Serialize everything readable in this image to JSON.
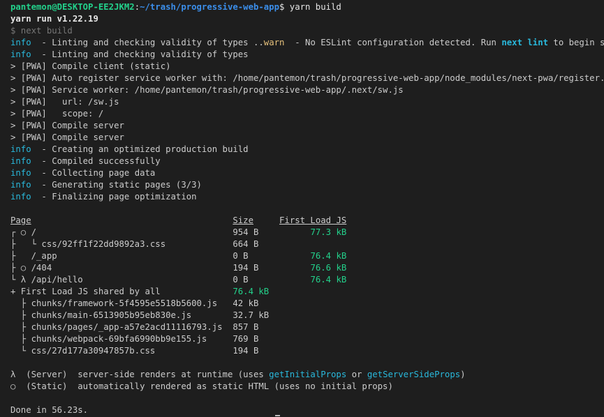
{
  "prompt": {
    "user_host": "pantemon@DESKTOP-EE2JKM2",
    "sep": ":",
    "path": "~/trash/progressive-web-app",
    "dollar": "$",
    "command": " yarn build"
  },
  "yarn_header": "yarn run v1.22.19",
  "next_build": "$ next build",
  "log1": {
    "tag": "info",
    "text": "  - Linting and checking validity of types ",
    "dots": "..",
    "warn": "warn",
    "pre": "  - No ESLint configuration detected. Run ",
    "cmd": "next lint",
    "post": " to begin setup"
  },
  "log2": {
    "tag": "info",
    "text": "  - Linting and checking validity of types"
  },
  "pwa_lines": [
    "> [PWA] Compile client (static)",
    "> [PWA] Auto register service worker with: /home/pantemon/trash/progressive-web-app/node_modules/next-pwa/register.js",
    "> [PWA] Service worker: /home/pantemon/trash/progressive-web-app/.next/sw.js",
    "> [PWA]   url: /sw.js",
    "> [PWA]   scope: /",
    "> [PWA] Compile server",
    "> [PWA] Compile server"
  ],
  "info_lines": [
    {
      "tag": "info",
      "text": "  - Creating an optimized production build"
    },
    {
      "tag": "info",
      "text": "  - Compiled successfully"
    },
    {
      "tag": "info",
      "text": "  - Collecting page data"
    },
    {
      "tag": "info",
      "text": "  - Generating static pages (3/3)"
    },
    {
      "tag": "info",
      "text": "  - Finalizing page optimization"
    }
  ],
  "table": {
    "page_label": "Page",
    "size_label": "Size",
    "first_load_label": "First Load JS",
    "rows": [
      {
        "tree": "┌ ○ ",
        "name": "/",
        "size": "954 B",
        "first_load": "77.3 kB"
      },
      {
        "tree": "├   └ ",
        "name": "css/92ff1f22dd9892a3.css",
        "size": "664 B",
        "first_load": ""
      },
      {
        "tree": "├   ",
        "name": "/_app",
        "size": "0 B",
        "first_load": "76.4 kB"
      },
      {
        "tree": "├ ○ ",
        "name": "/404",
        "size": "194 B",
        "first_load": "76.6 kB"
      },
      {
        "tree": "└ λ ",
        "name": "/api/hello",
        "size": "0 B",
        "first_load": "76.4 kB"
      }
    ],
    "shared_label": "+ First Load JS shared by all",
    "shared_size": "76.4 kB",
    "chunks": [
      {
        "tree": "  ├ ",
        "name": "chunks/framework-5f4595e5518b5600.js",
        "size": "42 kB"
      },
      {
        "tree": "  ├ ",
        "name": "chunks/main-6513905b95eb830e.js",
        "size": "32.7 kB"
      },
      {
        "tree": "  ├ ",
        "name": "chunks/pages/_app-a57e2acd11116793.js",
        "size": "857 B"
      },
      {
        "tree": "  ├ ",
        "name": "chunks/webpack-69bfa6990bb9e155.js",
        "size": "769 B"
      },
      {
        "tree": "  └ ",
        "name": "css/27d177a30947857b.css",
        "size": "194 B"
      }
    ]
  },
  "legend": {
    "server": {
      "symbol": "λ",
      "label": "  (Server)  server-side renders at runtime (uses ",
      "fn1": "getInitialProps",
      "mid": " or ",
      "fn2": "getServerSideProps",
      "end": ")"
    },
    "static": {
      "symbol": "○",
      "label": "  (Static)  automatically rendered as static HTML (uses no initial props)"
    }
  },
  "done": "Done in 56.23s.",
  "colors": {
    "background": "#1e1e1e",
    "prompt_green": "#23d18b",
    "path_blue": "#3b8eea",
    "info_cyan": "#29b8db",
    "warn_yellow": "#e5c07b",
    "size_green": "#23d18b"
  }
}
